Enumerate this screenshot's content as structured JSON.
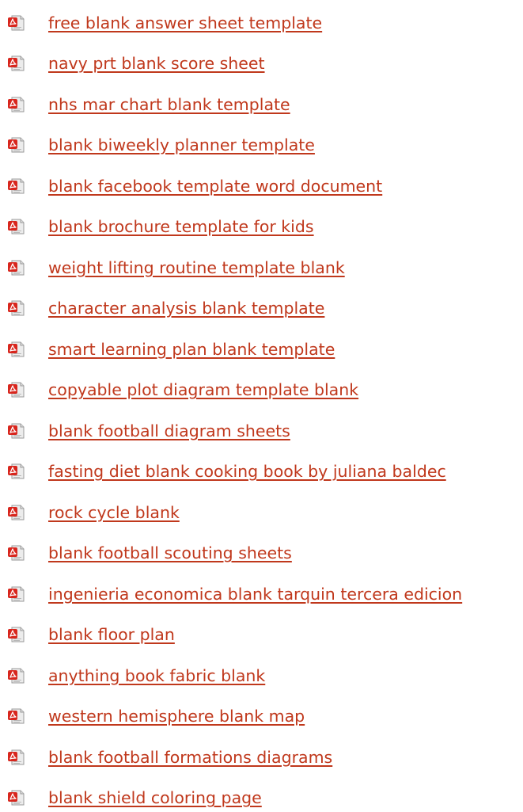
{
  "colors": {
    "link": "#c0381c",
    "icon_red": "#d8261d",
    "icon_page": "#ececec",
    "icon_border": "#9a9a9a"
  },
  "list": {
    "icon": "pdf-file-icon",
    "items": [
      {
        "label": "free blank answer sheet template"
      },
      {
        "label": "navy prt blank score sheet"
      },
      {
        "label": "nhs mar chart blank template"
      },
      {
        "label": "blank biweekly planner template"
      },
      {
        "label": "blank facebook template word document"
      },
      {
        "label": "blank brochure template for kids"
      },
      {
        "label": "weight lifting routine template blank"
      },
      {
        "label": "character analysis blank template"
      },
      {
        "label": "smart learning plan blank template"
      },
      {
        "label": "copyable plot diagram template blank"
      },
      {
        "label": "blank football diagram sheets"
      },
      {
        "label": "fasting diet blank cooking book by juliana baldec"
      },
      {
        "label": "rock cycle blank"
      },
      {
        "label": "blank football scouting sheets"
      },
      {
        "label": "ingenieria economica blank tarquin tercera edicion"
      },
      {
        "label": "blank floor plan"
      },
      {
        "label": "anything book fabric blank"
      },
      {
        "label": "western hemisphere blank map"
      },
      {
        "label": "blank football formations diagrams"
      },
      {
        "label": "blank shield coloring page"
      }
    ]
  }
}
